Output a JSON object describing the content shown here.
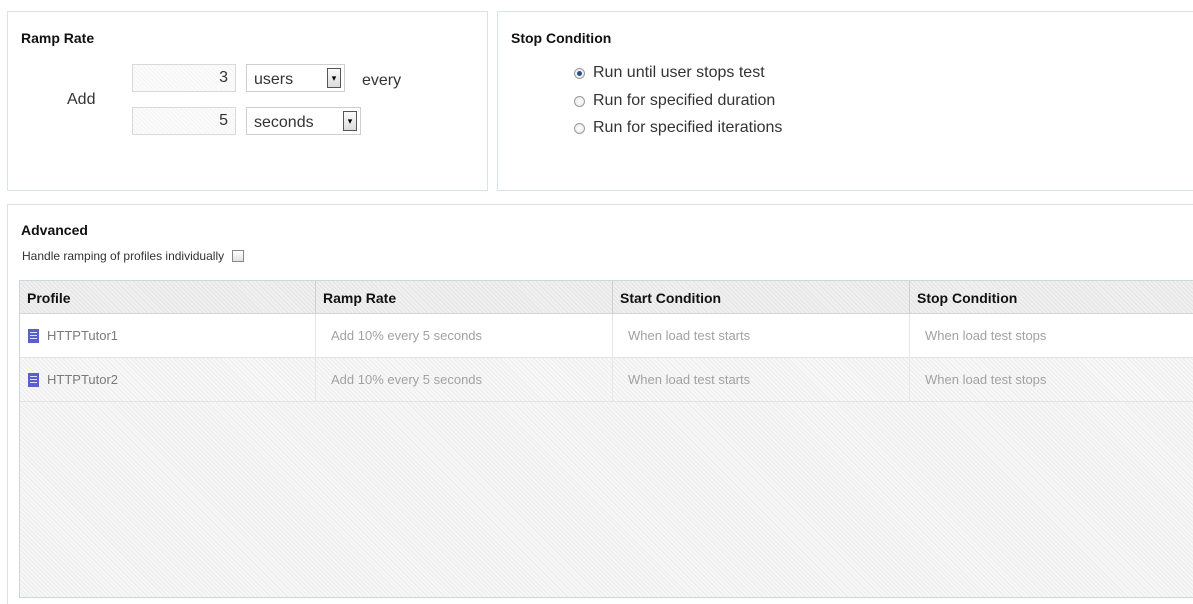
{
  "ramp_rate": {
    "title": "Ramp Rate",
    "add_label": "Add",
    "users_value": "3",
    "users_unit": "users",
    "every_label": "every",
    "seconds_value": "5",
    "seconds_unit": "seconds"
  },
  "stop_condition": {
    "title": "Stop Condition",
    "options": [
      {
        "label": "Run until user stops test",
        "selected": true
      },
      {
        "label": "Run for specified duration",
        "selected": false
      },
      {
        "label": "Run for specified iterations",
        "selected": false
      }
    ]
  },
  "advanced": {
    "title": "Advanced",
    "handle_individually_label": "Handle ramping of profiles individually",
    "handle_individually_checked": false,
    "columns": [
      "Profile",
      "Ramp Rate",
      "Start Condition",
      "Stop Condition"
    ],
    "rows": [
      {
        "profile": "HTTPTutor1",
        "ramp_rate": "Add 10% every 5 seconds",
        "start_condition": "When load test starts",
        "stop_condition": "When load test stops"
      },
      {
        "profile": "HTTPTutor2",
        "ramp_rate": "Add 10% every 5 seconds",
        "start_condition": "When load test starts",
        "stop_condition": "When load test stops"
      }
    ]
  },
  "icons": {
    "profile_icon": "document-icon",
    "dropdown_icon": "chevron-down-icon",
    "dropdown_glyph": "▾"
  },
  "colors": {
    "profile_icon": "#5a5fcf",
    "radio_selected": "#2a4f8c",
    "panel_border": "#d7e3ea"
  }
}
